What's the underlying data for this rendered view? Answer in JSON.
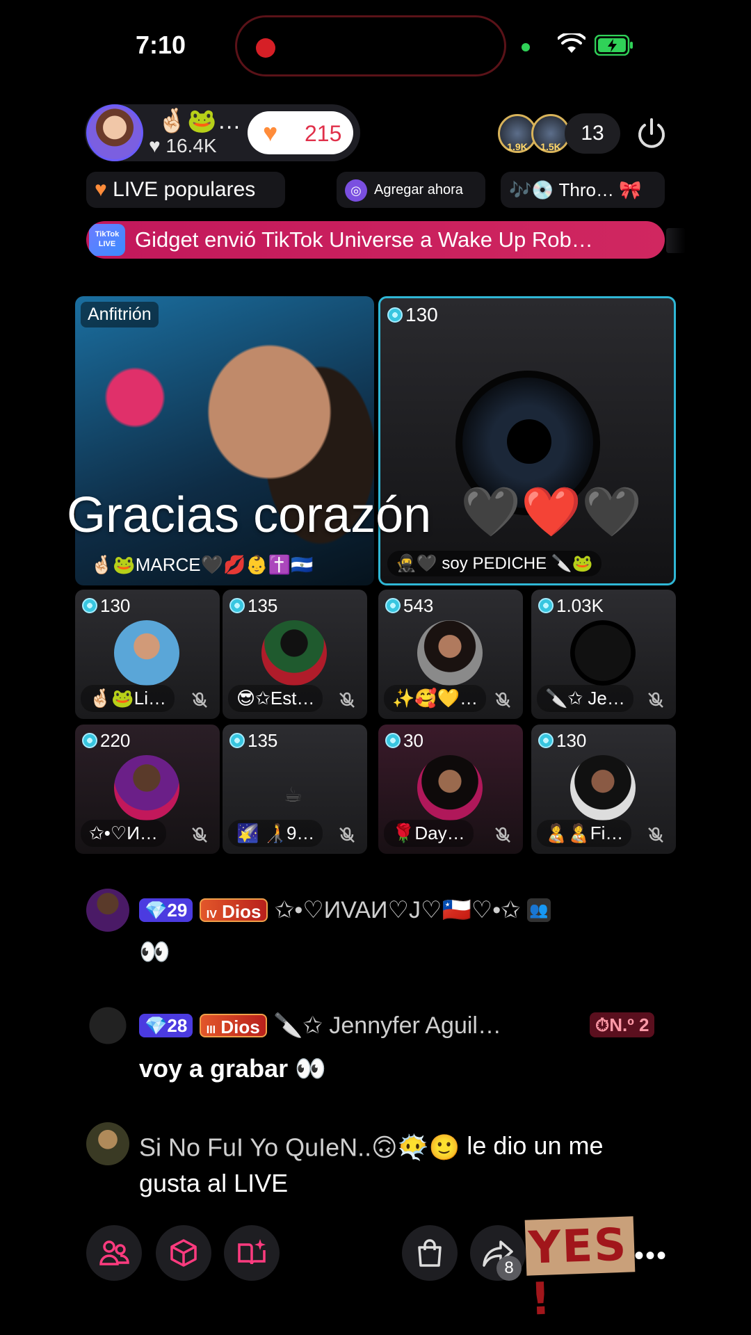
{
  "status_bar": {
    "time": "7:10"
  },
  "header": {
    "host_name": "🤞🏻🐸…",
    "host_likes": "16.4K",
    "follow_count": "215",
    "viewer_badges": [
      "1.9K",
      "1.5K"
    ],
    "viewer_count": "13"
  },
  "chips": {
    "live_popular": "LIVE populares",
    "add_now": "Agregar ahora",
    "music": "Thro…"
  },
  "banner": {
    "badge": "TikTok LIVE",
    "text": "Gidget envió TikTok Universe a Wake Up Rob…"
  },
  "host_tile": {
    "label": "Anfitrión",
    "name": "🤞🏻🐸MARCE🖤💋👶✝️🇸🇻"
  },
  "guest_main": {
    "score": "130",
    "name": "🥷🖤 soy PEDICHE 🔪🐸"
  },
  "overlay": {
    "message": "Gracias corazón",
    "hearts": "🖤❤️🖤"
  },
  "guests": [
    {
      "score": "130",
      "name": "🤞🏻🐸Li…"
    },
    {
      "score": "135",
      "name": "😎✩Est…"
    },
    {
      "score": "543",
      "name": "✨🥰💛…"
    },
    {
      "score": "1.03K",
      "name": "🔪✩ Je…"
    },
    {
      "score": "220",
      "name": "✩•♡И…"
    },
    {
      "score": "135",
      "name": "🌠 🧑‍🦯9…"
    },
    {
      "score": "30",
      "name": "🌹Day…"
    },
    {
      "score": "130",
      "name": "🧑‍🍼🧑‍🍼Fi…"
    }
  ],
  "chat": [
    {
      "level": "29",
      "rank_label": "Dios",
      "rank_num": "IV",
      "name": "✩•♡ИVAИ♡J♡🇨🇱♡•✩",
      "text": "👀"
    },
    {
      "level": "28",
      "rank_label": "Dios",
      "rank_num": "III",
      "name": "🔪✩ Jennyfer Aguil…",
      "badge": "N.º 2",
      "text": "voy a grabar 👀"
    },
    {
      "name": "Si No FuI Yo QuIeN..🙃😶‍🌫️🙂",
      "text": "le dio un me gusta al LIVE"
    }
  ],
  "bottom_bar": {
    "share_count": "8",
    "sticker": "YES !"
  },
  "colors": {
    "follow_heart": "#ff8c3a",
    "banner": "#c2185b",
    "gem_badge": "#4b3be0",
    "guest_border": "#2fb7d6"
  }
}
